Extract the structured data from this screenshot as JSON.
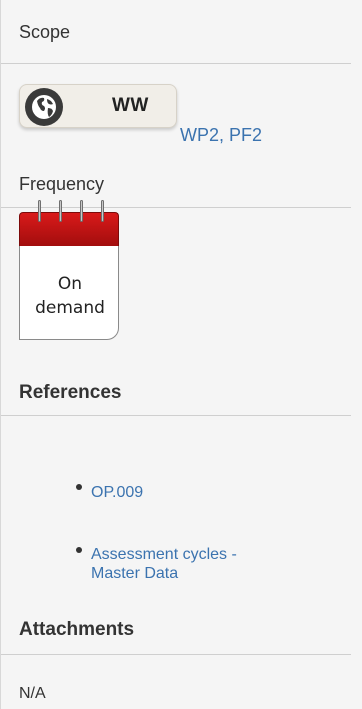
{
  "scope": {
    "label": "Scope",
    "badge_code": "WW",
    "badge_icon": "globe-icon",
    "extra": "WP2, PF2"
  },
  "frequency": {
    "label": "Frequency",
    "calendar_icon": "calendar-icon",
    "calendar_line1": "On",
    "calendar_line2": "demand"
  },
  "references": {
    "heading": "References",
    "items": [
      {
        "label": "OP.009"
      },
      {
        "label": "Assessment cycles - Master Data"
      }
    ]
  },
  "attachments": {
    "heading": "Attachments",
    "value": "N/A"
  },
  "colors": {
    "link": "#3b73af",
    "calendar_red": "#c21212",
    "panel_bg": "#f5f5f5"
  }
}
